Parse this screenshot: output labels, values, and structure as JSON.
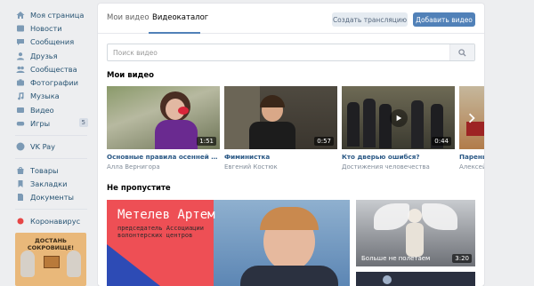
{
  "sidebar": {
    "items": [
      {
        "label": "Моя страница",
        "icon": "home-icon"
      },
      {
        "label": "Новости",
        "icon": "news-icon"
      },
      {
        "label": "Сообщения",
        "icon": "messages-icon"
      },
      {
        "label": "Друзья",
        "icon": "friends-icon"
      },
      {
        "label": "Сообщества",
        "icon": "communities-icon"
      },
      {
        "label": "Фотографии",
        "icon": "photos-icon"
      },
      {
        "label": "Музыка",
        "icon": "music-icon"
      },
      {
        "label": "Видео",
        "icon": "video-icon"
      },
      {
        "label": "Игры",
        "icon": "games-icon",
        "badge": "5"
      }
    ],
    "pay": {
      "label": "VK Pay",
      "icon": "vkpay-icon"
    },
    "items2": [
      {
        "label": "Товары",
        "icon": "goods-icon"
      },
      {
        "label": "Закладки",
        "icon": "bookmarks-icon"
      },
      {
        "label": "Документы",
        "icon": "documents-icon"
      }
    ],
    "covid": {
      "label": "Коронавирус",
      "icon": "covid-icon"
    },
    "promo": {
      "title": "ДОСТАНЬ СОКРОВИЩЕ!"
    }
  },
  "tabs": {
    "my_videos": "Мои видео",
    "catalog": "Видеокаталог"
  },
  "buttons": {
    "broadcast": "Создать трансляцию",
    "add_video": "Добавить видео"
  },
  "search": {
    "placeholder": "Поиск видео"
  },
  "sections": {
    "my_videos": "Мои видео",
    "dont_miss": "Не пропустите"
  },
  "videos": [
    {
      "title": "Основные правила осенней фотосес...",
      "author": "Алла Вернигора",
      "duration": "1:51"
    },
    {
      "title": "Фиминистка",
      "author": "Евгений Костюк",
      "duration": "0:57"
    },
    {
      "title": "Кто дверью ошибся?",
      "author": "Достижения человечества",
      "duration": "0:44"
    },
    {
      "title": "Парень п...",
      "author": "Алексей Е..."
    }
  ],
  "featured": {
    "name": "Метелев Артем",
    "subtitle_1": "председатель Ассоциации",
    "subtitle_2": "волонтерских центров"
  },
  "side_videos": [
    {
      "title": "Больше не полетаем",
      "duration": "3:20"
    }
  ],
  "colors": {
    "accent": "#5181b8",
    "link": "#2a5885",
    "nav_text": "#285473",
    "featured_bg": "#ee4f55"
  }
}
